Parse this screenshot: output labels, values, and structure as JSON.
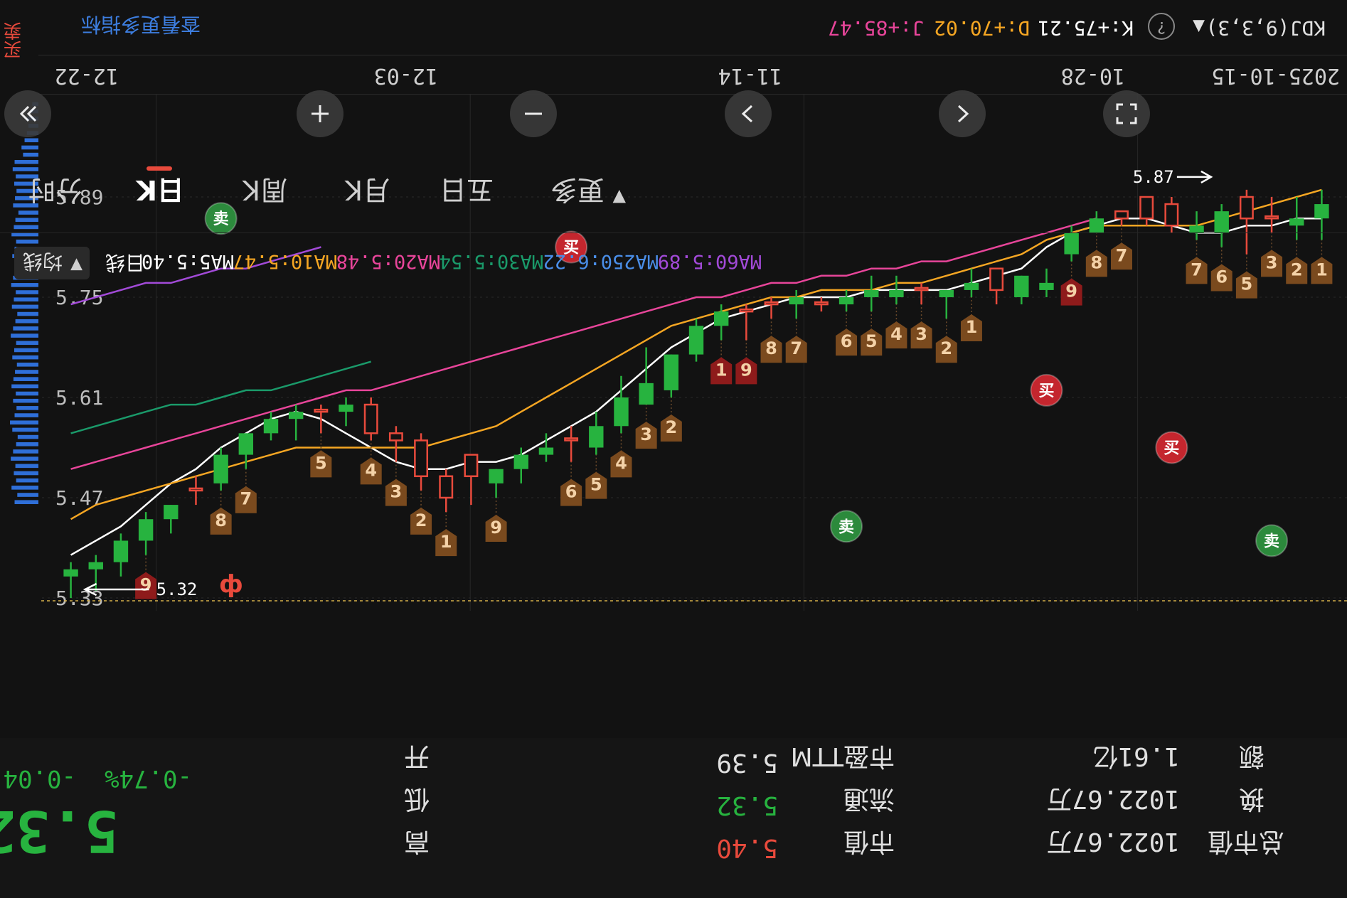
{
  "colors": {
    "up": "#e84a3c",
    "down": "#27b33f",
    "ma5": "#ffffff",
    "ma10": "#f5a623",
    "ma20": "#e8459a",
    "ma30": "#1a9a6a",
    "ma250": "#4a8ee8",
    "ma60": "#a24ad8",
    "accent_link": "#3d7ee0",
    "tag_orange": "#7a4a1e",
    "tag_red": "#8e1b1b"
  },
  "header": {
    "indicator": "KDJ(9,3,3)",
    "k_value": "K:+75.21",
    "d_value": "D:+70.02",
    "j_value": "J:+85.47",
    "more_link": "查看更多指标",
    "side_tab": "买卖"
  },
  "dates": [
    "2025-10-15",
    "10-28",
    "11-14",
    "12-03",
    "12-22"
  ],
  "price_axis": [
    "5.33",
    "5.47",
    "5.61",
    "5.75",
    "5.89"
  ],
  "price_marks": {
    "high_label": "5.32",
    "low_label": "5.87",
    "current_flag": "ф"
  },
  "chart_data": {
    "type": "candlestick",
    "note_units": "CNY per share",
    "price_min": 5.89,
    "price_max": 5.33,
    "candles": [
      {
        "o": 5.88,
        "c": 5.86,
        "h": 5.83,
        "l": 5.9
      },
      {
        "o": 5.86,
        "c": 5.85,
        "h": 5.83,
        "l": 5.89
      },
      {
        "o": 5.86,
        "c": 5.86,
        "h": 5.84,
        "l": 5.89
      },
      {
        "o": 5.86,
        "c": 5.89,
        "h": 5.81,
        "l": 5.9
      },
      {
        "o": 5.87,
        "c": 5.84,
        "h": 5.82,
        "l": 5.88
      },
      {
        "o": 5.85,
        "c": 5.84,
        "h": 5.83,
        "l": 5.87
      },
      {
        "o": 5.85,
        "c": 5.88,
        "h": 5.84,
        "l": 5.89
      },
      {
        "o": 5.86,
        "c": 5.89,
        "h": 5.85,
        "l": 5.89
      },
      {
        "o": 5.86,
        "c": 5.87,
        "h": 5.85,
        "l": 5.87
      },
      {
        "o": 5.86,
        "c": 5.84,
        "h": 5.84,
        "l": 5.87
      },
      {
        "o": 5.84,
        "c": 5.81,
        "h": 5.8,
        "l": 5.85
      },
      {
        "o": 5.77,
        "c": 5.76,
        "h": 5.75,
        "l": 5.79
      },
      {
        "o": 5.78,
        "c": 5.75,
        "h": 5.74,
        "l": 5.78
      },
      {
        "o": 5.76,
        "c": 5.79,
        "h": 5.74,
        "l": 5.79
      },
      {
        "o": 5.77,
        "c": 5.76,
        "h": 5.75,
        "l": 5.79
      },
      {
        "o": 5.76,
        "c": 5.75,
        "h": 5.72,
        "l": 5.76
      },
      {
        "o": 5.76,
        "c": 5.76,
        "h": 5.74,
        "l": 5.77
      },
      {
        "o": 5.76,
        "c": 5.75,
        "h": 5.74,
        "l": 5.78
      },
      {
        "o": 5.76,
        "c": 5.75,
        "h": 5.73,
        "l": 5.78
      },
      {
        "o": 5.75,
        "c": 5.74,
        "h": 5.73,
        "l": 5.76
      },
      {
        "o": 5.74,
        "c": 5.74,
        "h": 5.73,
        "l": 5.75
      },
      {
        "o": 5.75,
        "c": 5.74,
        "h": 5.72,
        "l": 5.76
      },
      {
        "o": 5.74,
        "c": 5.74,
        "h": 5.72,
        "l": 5.75
      },
      {
        "o": 5.73,
        "c": 5.73,
        "h": 5.69,
        "l": 5.74
      },
      {
        "o": 5.73,
        "c": 5.71,
        "h": 5.69,
        "l": 5.74
      },
      {
        "o": 5.71,
        "c": 5.67,
        "h": 5.66,
        "l": 5.72
      },
      {
        "o": 5.67,
        "c": 5.62,
        "h": 5.61,
        "l": 5.67
      },
      {
        "o": 5.63,
        "c": 5.6,
        "h": 5.6,
        "l": 5.68
      },
      {
        "o": 5.61,
        "c": 5.57,
        "h": 5.56,
        "l": 5.64
      },
      {
        "o": 5.57,
        "c": 5.54,
        "h": 5.53,
        "l": 5.59
      },
      {
        "o": 5.55,
        "c": 5.55,
        "h": 5.52,
        "l": 5.57
      },
      {
        "o": 5.54,
        "c": 5.53,
        "h": 5.52,
        "l": 5.56
      },
      {
        "o": 5.53,
        "c": 5.51,
        "h": 5.49,
        "l": 5.54
      },
      {
        "o": 5.51,
        "c": 5.49,
        "h": 5.47,
        "l": 5.51
      },
      {
        "o": 5.5,
        "c": 5.53,
        "h": 5.46,
        "l": 5.53
      },
      {
        "o": 5.47,
        "c": 5.5,
        "h": 5.45,
        "l": 5.51
      },
      {
        "o": 5.5,
        "c": 5.55,
        "h": 5.48,
        "l": 5.56
      },
      {
        "o": 5.55,
        "c": 5.56,
        "h": 5.52,
        "l": 5.57
      },
      {
        "o": 5.56,
        "c": 5.6,
        "h": 5.55,
        "l": 5.61
      },
      {
        "o": 5.6,
        "c": 5.59,
        "h": 5.57,
        "l": 5.61
      },
      {
        "o": 5.59,
        "c": 5.59,
        "h": 5.56,
        "l": 5.6
      },
      {
        "o": 5.59,
        "c": 5.58,
        "h": 5.55,
        "l": 5.6
      },
      {
        "o": 5.58,
        "c": 5.56,
        "h": 5.55,
        "l": 5.59
      },
      {
        "o": 5.56,
        "c": 5.53,
        "h": 5.51,
        "l": 5.56
      },
      {
        "o": 5.53,
        "c": 5.49,
        "h": 5.48,
        "l": 5.54
      },
      {
        "o": 5.48,
        "c": 5.48,
        "h": 5.46,
        "l": 5.5
      },
      {
        "o": 5.46,
        "c": 5.44,
        "h": 5.42,
        "l": 5.46
      },
      {
        "o": 5.44,
        "c": 5.41,
        "h": 5.39,
        "l": 5.45
      },
      {
        "o": 5.41,
        "c": 5.38,
        "h": 5.36,
        "l": 5.42
      },
      {
        "o": 5.38,
        "c": 5.37,
        "h": 5.34,
        "l": 5.39
      },
      {
        "o": 5.37,
        "c": 5.36,
        "h": 5.33,
        "l": 5.38
      }
    ],
    "ma_series": [
      {
        "name": "MA5",
        "values": [
          5.86,
          5.86,
          5.85,
          5.85,
          5.84,
          5.84,
          5.85,
          5.86,
          5.86,
          5.85,
          5.84,
          5.82,
          5.79,
          5.78,
          5.77,
          5.76,
          5.76,
          5.76,
          5.76,
          5.75,
          5.75,
          5.75,
          5.74,
          5.73,
          5.72,
          5.7,
          5.68,
          5.65,
          5.62,
          5.59,
          5.57,
          5.55,
          5.53,
          5.52,
          5.52,
          5.51,
          5.51,
          5.52,
          5.54,
          5.56,
          5.58,
          5.59,
          5.58,
          5.56,
          5.54,
          5.51,
          5.49,
          5.46,
          5.43,
          5.41,
          5.39
        ]
      },
      {
        "name": "MA10",
        "values": [
          5.9,
          5.89,
          5.88,
          5.87,
          5.86,
          5.85,
          5.85,
          5.85,
          5.85,
          5.85,
          5.84,
          5.83,
          5.81,
          5.8,
          5.79,
          5.78,
          5.77,
          5.77,
          5.76,
          5.76,
          5.76,
          5.75,
          5.75,
          5.74,
          5.73,
          5.72,
          5.71,
          5.69,
          5.67,
          5.65,
          5.63,
          5.61,
          5.59,
          5.57,
          5.56,
          5.55,
          5.54,
          5.54,
          5.54,
          5.54,
          5.54,
          5.54,
          5.53,
          5.52,
          5.51,
          5.5,
          5.49,
          5.48,
          5.47,
          5.46,
          5.44
        ]
      },
      {
        "name": "MA20",
        "values": [
          null,
          null,
          null,
          null,
          null,
          null,
          null,
          null,
          null,
          5.86,
          5.85,
          5.84,
          5.83,
          5.82,
          5.81,
          5.8,
          5.8,
          5.79,
          5.79,
          5.78,
          5.78,
          5.77,
          5.77,
          5.76,
          5.75,
          5.75,
          5.74,
          5.73,
          5.72,
          5.71,
          5.7,
          5.69,
          5.68,
          5.67,
          5.66,
          5.65,
          5.64,
          5.63,
          5.62,
          5.62,
          5.61,
          5.6,
          5.59,
          5.58,
          5.57,
          5.56,
          5.55,
          5.54,
          5.53,
          5.52,
          5.51
        ]
      },
      {
        "name": "MA30",
        "values": [
          null,
          null,
          null,
          null,
          null,
          null,
          null,
          null,
          null,
          null,
          null,
          null,
          null,
          null,
          null,
          null,
          null,
          null,
          null,
          null,
          null,
          null,
          null,
          null,
          null,
          null,
          null,
          null,
          null,
          null,
          null,
          null,
          null,
          null,
          null,
          null,
          null,
          null,
          5.66,
          5.65,
          5.64,
          5.63,
          5.62,
          5.62,
          5.61,
          5.6,
          5.6,
          5.59,
          5.58,
          5.57,
          5.56
        ]
      },
      {
        "name": "MA60",
        "values": [
          null,
          null,
          null,
          null,
          null,
          null,
          null,
          null,
          null,
          null,
          null,
          null,
          null,
          null,
          null,
          null,
          null,
          null,
          null,
          null,
          null,
          null,
          null,
          null,
          null,
          null,
          null,
          null,
          null,
          null,
          null,
          null,
          null,
          null,
          null,
          null,
          null,
          null,
          null,
          null,
          5.82,
          5.81,
          5.8,
          5.79,
          5.79,
          5.78,
          5.77,
          5.77,
          5.76,
          5.75,
          5.74
        ]
      }
    ],
    "count_tags": [
      {
        "i": 47,
        "text": "9",
        "kind": "red"
      },
      {
        "i": 44,
        "text": "8",
        "kind": "orange"
      },
      {
        "i": 43,
        "text": "7",
        "kind": "orange"
      },
      {
        "i": 40,
        "text": "5",
        "kind": "orange"
      },
      {
        "i": 38,
        "text": "4",
        "kind": "orange"
      },
      {
        "i": 37,
        "text": "3",
        "kind": "orange"
      },
      {
        "i": 36,
        "text": "2",
        "kind": "orange"
      },
      {
        "i": 35,
        "text": "1",
        "kind": "orange"
      },
      {
        "i": 33,
        "text": "9",
        "kind": "orange"
      },
      {
        "i": 30,
        "text": "6",
        "kind": "orange"
      },
      {
        "i": 29,
        "text": "5",
        "kind": "orange"
      },
      {
        "i": 28,
        "text": "4",
        "kind": "orange"
      },
      {
        "i": 27,
        "text": "3",
        "kind": "orange"
      },
      {
        "i": 26,
        "text": "2",
        "kind": "orange"
      },
      {
        "i": 24,
        "text": "1",
        "kind": "red"
      },
      {
        "i": 23,
        "text": "9",
        "kind": "red"
      },
      {
        "i": 22,
        "text": "8",
        "kind": "orange"
      },
      {
        "i": 21,
        "text": "7",
        "kind": "orange"
      },
      {
        "i": 19,
        "text": "6",
        "kind": "orange"
      },
      {
        "i": 18,
        "text": "5",
        "kind": "orange"
      },
      {
        "i": 17,
        "text": "4",
        "kind": "orange"
      },
      {
        "i": 16,
        "text": "3",
        "kind": "orange"
      },
      {
        "i": 15,
        "text": "2",
        "kind": "orange"
      },
      {
        "i": 14,
        "text": "1",
        "kind": "orange"
      },
      {
        "i": 10,
        "text": "9",
        "kind": "red"
      },
      {
        "i": 9,
        "text": "8",
        "kind": "orange"
      },
      {
        "i": 8,
        "text": "7",
        "kind": "orange"
      },
      {
        "i": 5,
        "text": "7",
        "kind": "orange"
      },
      {
        "i": 4,
        "text": "6",
        "kind": "orange"
      },
      {
        "i": 3,
        "text": "5",
        "kind": "orange"
      },
      {
        "i": 2,
        "text": "3",
        "kind": "orange"
      },
      {
        "i": 1,
        "text": "2",
        "kind": "orange"
      },
      {
        "i": 0,
        "text": "1",
        "kind": "orange"
      }
    ],
    "signal_badges": [
      {
        "i": 44,
        "text": "卖",
        "kind": "sell",
        "price": 5.86
      },
      {
        "i": 30,
        "text": "买",
        "kind": "buy",
        "price": 5.82
      },
      {
        "i": 19,
        "text": "卖",
        "kind": "sell",
        "price": 5.43
      },
      {
        "i": 11,
        "text": "买",
        "kind": "buy",
        "price": 5.62
      },
      {
        "i": 6,
        "text": "买",
        "kind": "buy",
        "price": 5.54
      },
      {
        "i": 2,
        "text": "卖",
        "kind": "sell",
        "price": 5.41
      }
    ],
    "volume_bars": [
      0.62,
      0.55,
      0.7,
      0.58,
      0.64,
      0.6,
      0.72,
      0.66,
      0.58,
      0.54,
      0.68,
      0.74,
      0.62,
      0.57,
      0.66,
      0.59,
      0.7,
      0.65,
      0.61,
      0.56,
      0.68,
      0.63,
      0.58,
      0.72,
      0.66,
      0.6,
      0.55,
      0.69,
      0.64,
      0.59,
      0.71,
      0.66,
      0.6,
      0.55,
      0.68,
      0.62,
      0.58,
      0.7,
      0.64,
      0.6,
      0.52,
      0.66,
      0.61,
      0.57,
      0.63,
      0.59,
      0.67,
      0.62,
      0.4,
      0.44,
      0.36,
      0.3,
      0.26,
      0.3,
      0.2,
      0.16
    ]
  },
  "ma_labels": {
    "toggle": "均线",
    "daily": "日线",
    "ma5": "MA5:5.40",
    "ma10": "MA10:5.47",
    "ma20": "MA20:5.48",
    "ma30": "MA30:5.54",
    "ma250": "MA250:6.22",
    "ma60": "MA60:5.89"
  },
  "tabs": [
    "分时",
    "日K",
    "周K",
    "月K",
    "五日",
    "更多"
  ],
  "quote": {
    "price": "5.32",
    "change": "-0.04",
    "change_pct": "-0.74%",
    "open_label": "开",
    "open_value": "5.39",
    "low_label": "低",
    "low_value": "5.32",
    "high_label": "高",
    "high_value": "5.40",
    "mid_label1": "市盈TTM",
    "mid_label2": "流通",
    "mid_label3": "市值",
    "r_label1": "额",
    "r_value1": "1.61亿",
    "r_label2": "换",
    "r_value2": "1022.67万",
    "r_label3": "总市值",
    "r_value3": "1022.67万"
  }
}
